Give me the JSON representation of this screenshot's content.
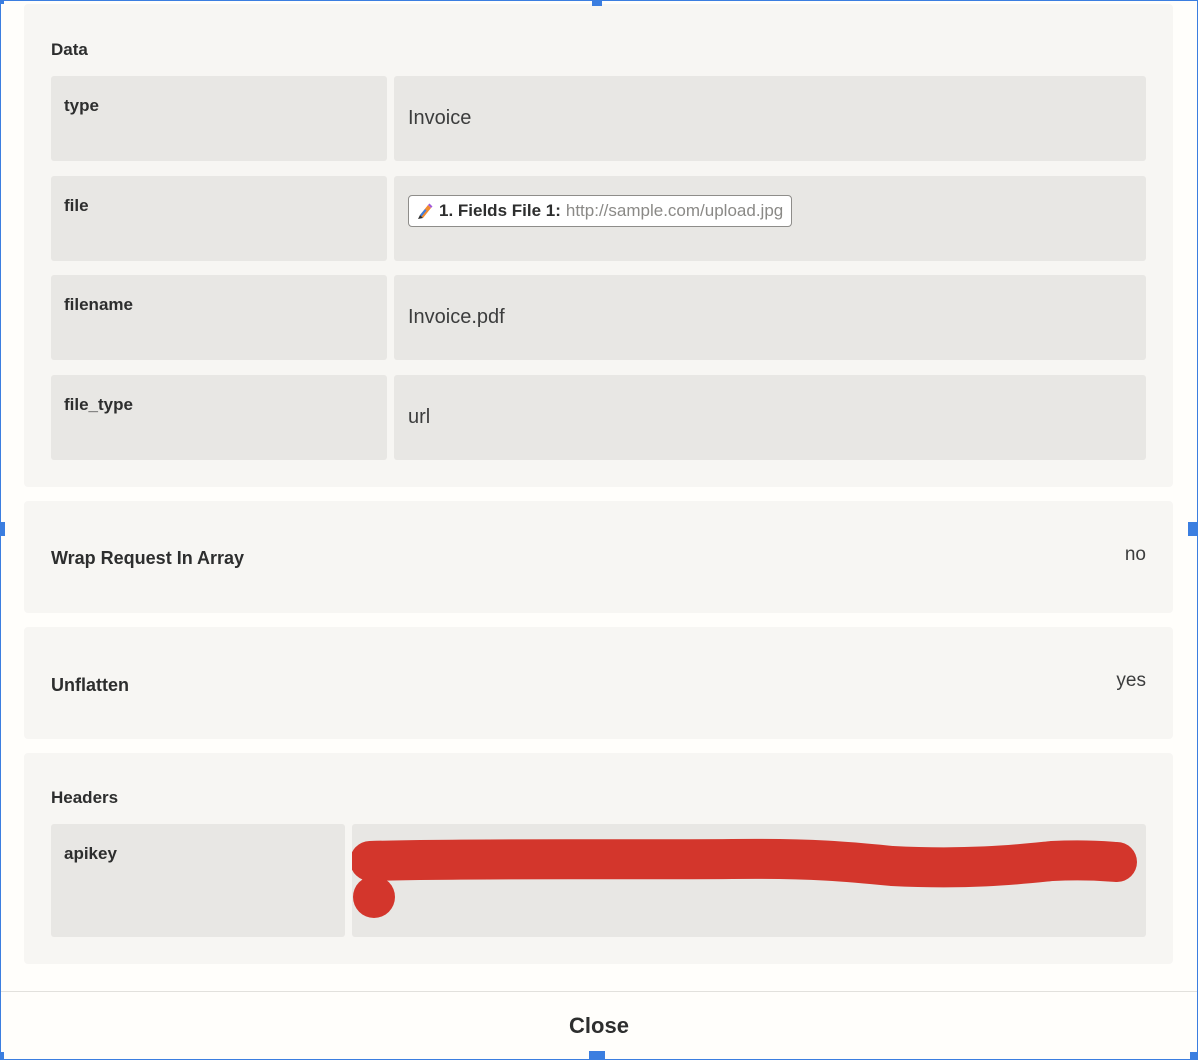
{
  "data_section": {
    "title": "Data",
    "fields": [
      {
        "key": "type",
        "value": "Invoice"
      },
      {
        "key": "file",
        "pill_label": "1. Fields File 1:",
        "pill_value": "http://sample.com/upload.jpg"
      },
      {
        "key": "filename",
        "value": "Invoice.pdf"
      },
      {
        "key": "file_type",
        "value": "url"
      }
    ]
  },
  "wrap_request": {
    "label": "Wrap Request In Array",
    "value": "no"
  },
  "unflatten": {
    "label": "Unflatten",
    "value": "yes"
  },
  "headers": {
    "title": "Headers",
    "fields": [
      {
        "key": "apikey"
      }
    ]
  },
  "footer": {
    "close_label": "Close"
  },
  "icons": {
    "pill_icon": "formatter-pencil-icon",
    "redaction": "red-scribble-redaction"
  },
  "colors": {
    "selection_blue": "#3b7ee0",
    "redaction_red": "#d3362c",
    "panel_bg": "#f7f6f3",
    "cell_bg": "#e8e7e4"
  }
}
